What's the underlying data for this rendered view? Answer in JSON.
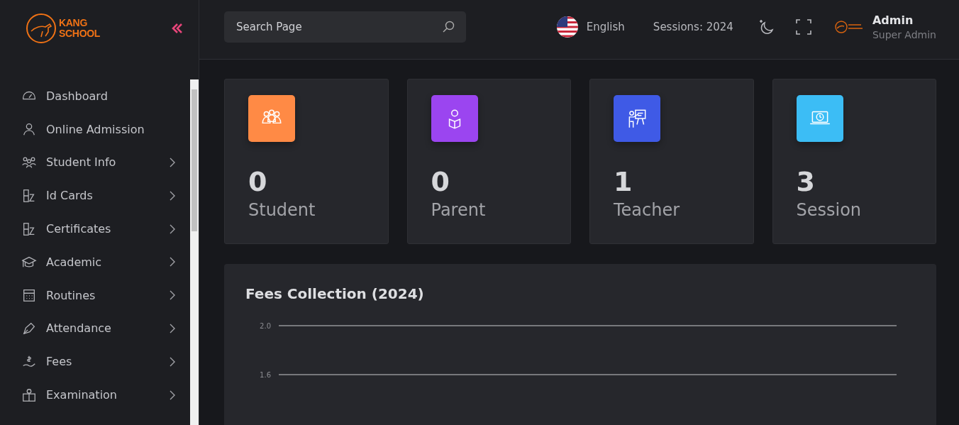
{
  "sidebar": {
    "logo": {
      "line1": "KANG",
      "line2": "SCHOOL"
    },
    "items": [
      {
        "label": "Dashboard",
        "has_submenu": false
      },
      {
        "label": "Online Admission",
        "has_submenu": false
      },
      {
        "label": "Student Info",
        "has_submenu": true
      },
      {
        "label": "Id Cards",
        "has_submenu": true
      },
      {
        "label": "Certificates",
        "has_submenu": true
      },
      {
        "label": "Academic",
        "has_submenu": true
      },
      {
        "label": "Routines",
        "has_submenu": true
      },
      {
        "label": "Attendance",
        "has_submenu": true
      },
      {
        "label": "Fees",
        "has_submenu": true
      },
      {
        "label": "Examination",
        "has_submenu": true
      }
    ]
  },
  "header": {
    "search": {
      "placeholder": "Search Page"
    },
    "language": "English",
    "session": "Sessions: 2024",
    "user": {
      "name": "Admin",
      "role": "Super Admin"
    }
  },
  "stats": [
    {
      "value": "0",
      "label": "Student",
      "color": "#ff8a45"
    },
    {
      "value": "0",
      "label": "Parent",
      "color": "#9b45f0"
    },
    {
      "value": "1",
      "label": "Teacher",
      "color": "#3f5ae6"
    },
    {
      "value": "3",
      "label": "Session",
      "color": "#3cbdf5"
    }
  ],
  "fees_chart": {
    "title": "Fees Collection (2024)",
    "gridline_labels": [
      "2.0",
      "1.6"
    ]
  }
}
